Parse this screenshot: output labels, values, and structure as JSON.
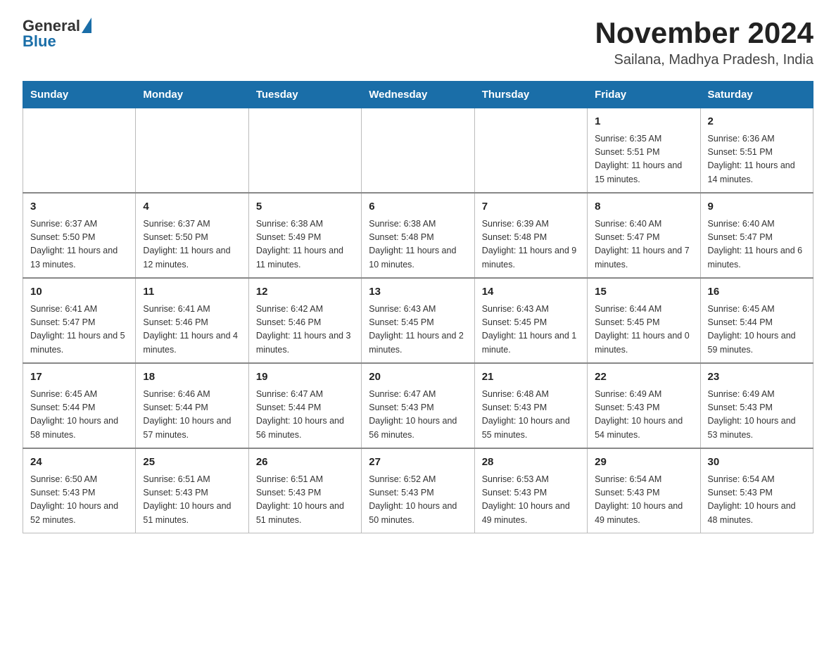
{
  "header": {
    "logo_general": "General",
    "logo_blue": "Blue",
    "month_title": "November 2024",
    "subtitle": "Sailana, Madhya Pradesh, India"
  },
  "weekdays": [
    "Sunday",
    "Monday",
    "Tuesday",
    "Wednesday",
    "Thursday",
    "Friday",
    "Saturday"
  ],
  "weeks": [
    [
      {
        "day": "",
        "info": ""
      },
      {
        "day": "",
        "info": ""
      },
      {
        "day": "",
        "info": ""
      },
      {
        "day": "",
        "info": ""
      },
      {
        "day": "",
        "info": ""
      },
      {
        "day": "1",
        "info": "Sunrise: 6:35 AM\nSunset: 5:51 PM\nDaylight: 11 hours and 15 minutes."
      },
      {
        "day": "2",
        "info": "Sunrise: 6:36 AM\nSunset: 5:51 PM\nDaylight: 11 hours and 14 minutes."
      }
    ],
    [
      {
        "day": "3",
        "info": "Sunrise: 6:37 AM\nSunset: 5:50 PM\nDaylight: 11 hours and 13 minutes."
      },
      {
        "day": "4",
        "info": "Sunrise: 6:37 AM\nSunset: 5:50 PM\nDaylight: 11 hours and 12 minutes."
      },
      {
        "day": "5",
        "info": "Sunrise: 6:38 AM\nSunset: 5:49 PM\nDaylight: 11 hours and 11 minutes."
      },
      {
        "day": "6",
        "info": "Sunrise: 6:38 AM\nSunset: 5:48 PM\nDaylight: 11 hours and 10 minutes."
      },
      {
        "day": "7",
        "info": "Sunrise: 6:39 AM\nSunset: 5:48 PM\nDaylight: 11 hours and 9 minutes."
      },
      {
        "day": "8",
        "info": "Sunrise: 6:40 AM\nSunset: 5:47 PM\nDaylight: 11 hours and 7 minutes."
      },
      {
        "day": "9",
        "info": "Sunrise: 6:40 AM\nSunset: 5:47 PM\nDaylight: 11 hours and 6 minutes."
      }
    ],
    [
      {
        "day": "10",
        "info": "Sunrise: 6:41 AM\nSunset: 5:47 PM\nDaylight: 11 hours and 5 minutes."
      },
      {
        "day": "11",
        "info": "Sunrise: 6:41 AM\nSunset: 5:46 PM\nDaylight: 11 hours and 4 minutes."
      },
      {
        "day": "12",
        "info": "Sunrise: 6:42 AM\nSunset: 5:46 PM\nDaylight: 11 hours and 3 minutes."
      },
      {
        "day": "13",
        "info": "Sunrise: 6:43 AM\nSunset: 5:45 PM\nDaylight: 11 hours and 2 minutes."
      },
      {
        "day": "14",
        "info": "Sunrise: 6:43 AM\nSunset: 5:45 PM\nDaylight: 11 hours and 1 minute."
      },
      {
        "day": "15",
        "info": "Sunrise: 6:44 AM\nSunset: 5:45 PM\nDaylight: 11 hours and 0 minutes."
      },
      {
        "day": "16",
        "info": "Sunrise: 6:45 AM\nSunset: 5:44 PM\nDaylight: 10 hours and 59 minutes."
      }
    ],
    [
      {
        "day": "17",
        "info": "Sunrise: 6:45 AM\nSunset: 5:44 PM\nDaylight: 10 hours and 58 minutes."
      },
      {
        "day": "18",
        "info": "Sunrise: 6:46 AM\nSunset: 5:44 PM\nDaylight: 10 hours and 57 minutes."
      },
      {
        "day": "19",
        "info": "Sunrise: 6:47 AM\nSunset: 5:44 PM\nDaylight: 10 hours and 56 minutes."
      },
      {
        "day": "20",
        "info": "Sunrise: 6:47 AM\nSunset: 5:43 PM\nDaylight: 10 hours and 56 minutes."
      },
      {
        "day": "21",
        "info": "Sunrise: 6:48 AM\nSunset: 5:43 PM\nDaylight: 10 hours and 55 minutes."
      },
      {
        "day": "22",
        "info": "Sunrise: 6:49 AM\nSunset: 5:43 PM\nDaylight: 10 hours and 54 minutes."
      },
      {
        "day": "23",
        "info": "Sunrise: 6:49 AM\nSunset: 5:43 PM\nDaylight: 10 hours and 53 minutes."
      }
    ],
    [
      {
        "day": "24",
        "info": "Sunrise: 6:50 AM\nSunset: 5:43 PM\nDaylight: 10 hours and 52 minutes."
      },
      {
        "day": "25",
        "info": "Sunrise: 6:51 AM\nSunset: 5:43 PM\nDaylight: 10 hours and 51 minutes."
      },
      {
        "day": "26",
        "info": "Sunrise: 6:51 AM\nSunset: 5:43 PM\nDaylight: 10 hours and 51 minutes."
      },
      {
        "day": "27",
        "info": "Sunrise: 6:52 AM\nSunset: 5:43 PM\nDaylight: 10 hours and 50 minutes."
      },
      {
        "day": "28",
        "info": "Sunrise: 6:53 AM\nSunset: 5:43 PM\nDaylight: 10 hours and 49 minutes."
      },
      {
        "day": "29",
        "info": "Sunrise: 6:54 AM\nSunset: 5:43 PM\nDaylight: 10 hours and 49 minutes."
      },
      {
        "day": "30",
        "info": "Sunrise: 6:54 AM\nSunset: 5:43 PM\nDaylight: 10 hours and 48 minutes."
      }
    ]
  ]
}
